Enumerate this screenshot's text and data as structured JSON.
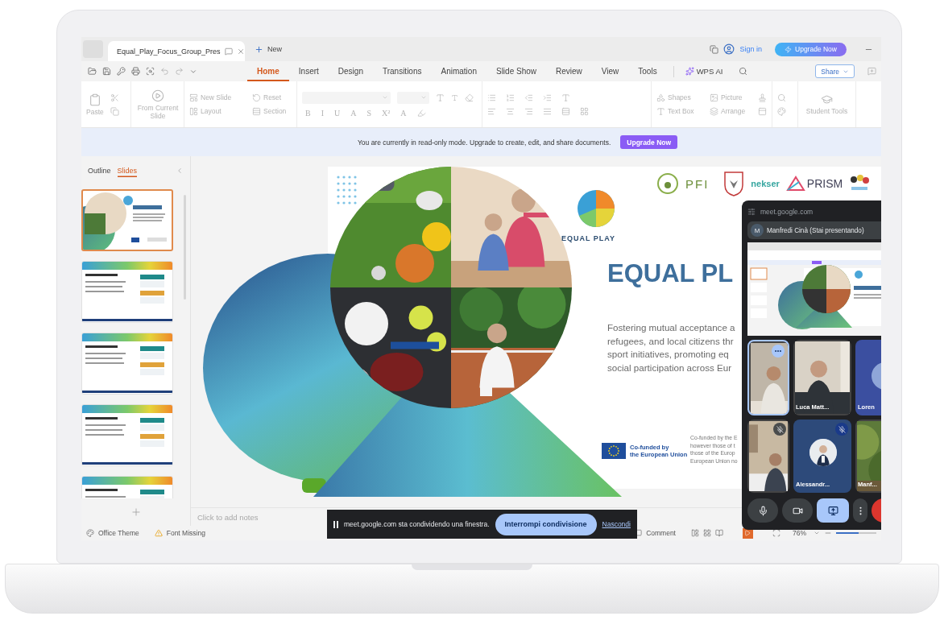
{
  "tab_bar": {
    "document_title": "Equal_Play_Focus_Group_Pres",
    "new_tab": "New",
    "sign_in": "Sign in",
    "upgrade_button": "Upgrade Now"
  },
  "menu": {
    "tabs": [
      {
        "label": "Home",
        "selected": true
      },
      {
        "label": "Insert",
        "selected": false
      },
      {
        "label": "Design",
        "selected": false
      },
      {
        "label": "Transitions",
        "selected": false
      },
      {
        "label": "Animation",
        "selected": false
      },
      {
        "label": "Slide Show",
        "selected": false
      },
      {
        "label": "Review",
        "selected": false
      },
      {
        "label": "View",
        "selected": false
      },
      {
        "label": "Tools",
        "selected": false
      }
    ],
    "ai_button": "WPS AI",
    "share_button": "Share"
  },
  "ribbon": {
    "paste": "Paste",
    "from_current_slide": "From Current Slide",
    "new_slide": "New Slide",
    "reset": "Reset",
    "layout": "Layout",
    "section": "Section",
    "format_buttons": [
      "B",
      "I",
      "U",
      "A",
      "S",
      "X²",
      "A"
    ],
    "shapes": "Shapes",
    "picture": "Picture",
    "text_box": "Text Box",
    "arrange": "Arrange",
    "student_tools": "Student Tools"
  },
  "banner": {
    "message": "You are currently in read-only mode. Upgrade to create, edit, and share documents.",
    "button": "Upgrade Now"
  },
  "side_panel": {
    "tabs": [
      {
        "label": "Outline",
        "selected": false
      },
      {
        "label": "Slides",
        "selected": true
      }
    ],
    "slides": [
      {
        "kind": "title",
        "selected": true
      },
      {
        "kind": "content",
        "selected": false
      },
      {
        "kind": "content",
        "selected": false
      },
      {
        "kind": "content",
        "selected": false
      },
      {
        "kind": "content",
        "selected": false
      }
    ]
  },
  "slide": {
    "logo_text": "EQUAL PLAY",
    "partners": [
      "PFI",
      "nekser",
      "PRISM"
    ],
    "title": "EQUAL PL",
    "body": [
      "Fostering mutual acceptance a",
      "refugees, and local citizens thr",
      "sport initiatives, promoting eq",
      "social participation across Eur"
    ],
    "eu_label": [
      "Co-funded by",
      "the European Union"
    ],
    "disclaimer": [
      "Co-funded by the E",
      "however those of t",
      "those of the Europ",
      "European Union no"
    ]
  },
  "notes": {
    "placeholder": "Click to add notes"
  },
  "status_bar": {
    "theme": "Office Theme",
    "font_warning": "Font Missing",
    "comment": "Comment",
    "zoom": {
      "label": "76%",
      "level": 0.55
    }
  },
  "meet_panel": {
    "url": "meet.google.com",
    "presenter": {
      "initial": "M",
      "label": "Manfredi Cinà (Stai presentando)"
    },
    "tiles": [
      {
        "kind": "video",
        "selected": true,
        "muted": false
      },
      {
        "kind": "video",
        "name": "Luca Matt...",
        "selected": false,
        "muted": false
      },
      {
        "kind": "avatar",
        "name": "Loren",
        "selected": false,
        "muted": false
      },
      {
        "kind": "video",
        "selected": false,
        "muted": true
      },
      {
        "kind": "photo-avatar",
        "name": "Alessandr...",
        "selected": false,
        "muted": true
      },
      {
        "kind": "video",
        "name": "Manf...",
        "selected": false,
        "muted": false
      }
    ],
    "controls": [
      {
        "kind": "mic",
        "on": false
      },
      {
        "kind": "camera",
        "on": false
      },
      {
        "kind": "present",
        "on": true
      },
      {
        "kind": "more",
        "on": false
      },
      {
        "kind": "end",
        "on": false
      }
    ]
  },
  "share_bar": {
    "message": "meet.google.com sta condividendo una finestra.",
    "stop_button": "Interrompi condivisione",
    "hide_link": "Nascondi"
  }
}
